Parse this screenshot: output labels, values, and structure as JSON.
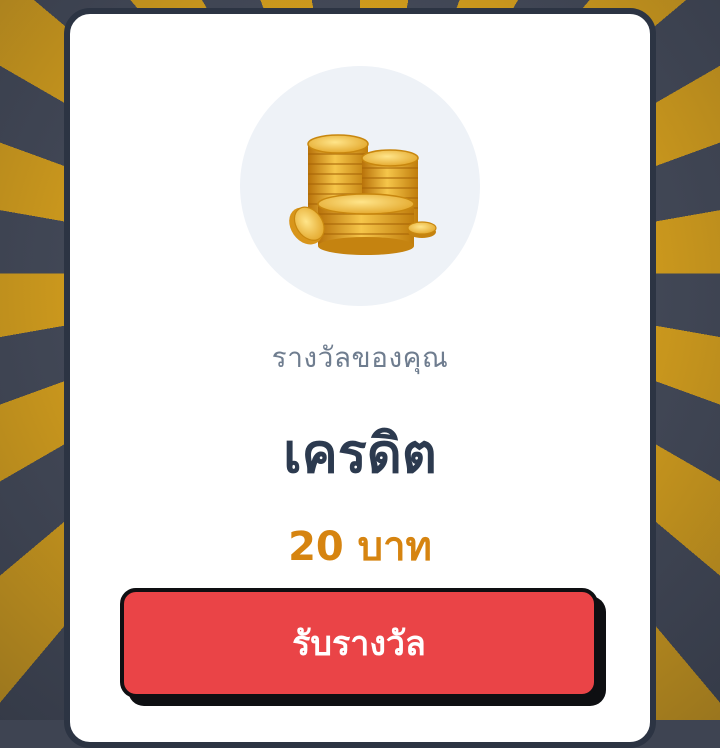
{
  "reward": {
    "image_icon": "gold-coins-icon",
    "subtitle": "รางวัลของคุณ",
    "title": "เครดิต",
    "amount": "20 บาท",
    "claim_label": "รับรางวัล"
  },
  "colors": {
    "ray_gold": "#e2a81c",
    "ray_dark": "#474d5c",
    "card_border": "#2c3443",
    "amount": "#d68410",
    "button": "#ea4447"
  }
}
